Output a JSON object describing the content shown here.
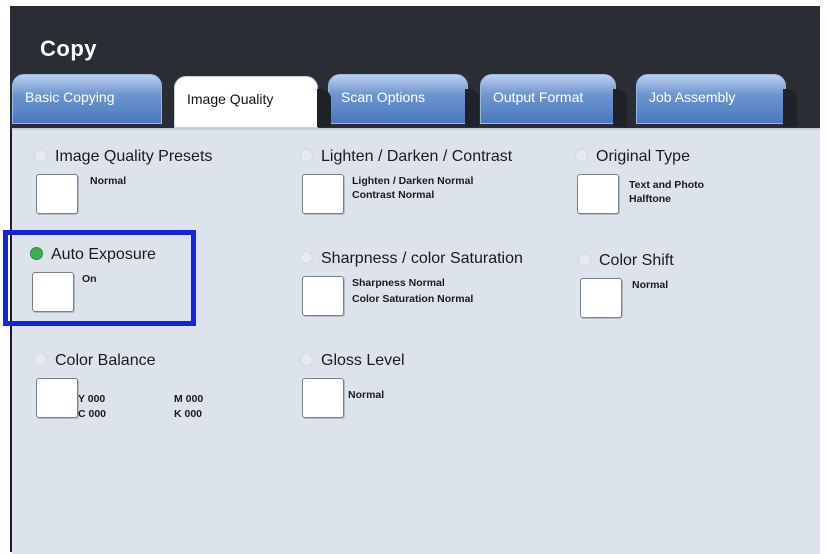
{
  "app": {
    "title": "Copy"
  },
  "tabs": [
    {
      "label": "Basic Copying",
      "active": false
    },
    {
      "label": "Image Quality",
      "active": true
    },
    {
      "label": "Scan Options",
      "active": false
    },
    {
      "label": "Output Format",
      "active": false
    },
    {
      "label": "Job Assembly",
      "active": false
    }
  ],
  "groups": {
    "image_quality_presets": {
      "label": "Image Quality Presets",
      "indicator_on": false,
      "values": [
        "Normal"
      ]
    },
    "lighten_darken_contrast": {
      "label": "Lighten / Darken / Contrast",
      "indicator_on": false,
      "values": [
        "Lighten / Darken Normal",
        "Contrast Normal"
      ]
    },
    "original_type": {
      "label": "Original Type",
      "indicator_on": false,
      "values": [
        "Text and Photo",
        "Halftone"
      ]
    },
    "auto_exposure": {
      "label": "Auto Exposure",
      "indicator_on": true,
      "values": [
        "On"
      ]
    },
    "sharpness_saturation": {
      "label": "Sharpness / color Saturation",
      "indicator_on": false,
      "values": [
        "Sharpness Normal",
        "Color Saturation Normal"
      ]
    },
    "color_shift": {
      "label": "Color Shift",
      "indicator_on": false,
      "values": [
        "Normal"
      ]
    },
    "color_balance": {
      "label": "Color Balance",
      "indicator_on": false,
      "values": {
        "y": "Y 000",
        "m": "M 000",
        "c": "C 000",
        "k": "K 000"
      }
    },
    "gloss_level": {
      "label": "Gloss Level",
      "indicator_on": false,
      "values": [
        "Normal"
      ]
    }
  },
  "colors": {
    "highlight": "#1424e0",
    "indicator_on": "#3fae4f",
    "title_bar": "#2a2d33",
    "panel_bg": "#dde3ed",
    "tab_blue": "#4a78c0"
  }
}
